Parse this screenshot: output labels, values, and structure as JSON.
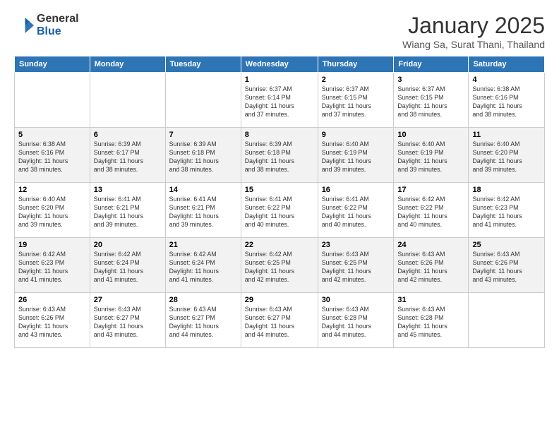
{
  "header": {
    "logo_general": "General",
    "logo_blue": "Blue",
    "month_title": "January 2025",
    "location": "Wiang Sa, Surat Thani, Thailand"
  },
  "days_of_week": [
    "Sunday",
    "Monday",
    "Tuesday",
    "Wednesday",
    "Thursday",
    "Friday",
    "Saturday"
  ],
  "weeks": [
    [
      {
        "num": "",
        "info": ""
      },
      {
        "num": "",
        "info": ""
      },
      {
        "num": "",
        "info": ""
      },
      {
        "num": "1",
        "info": "Sunrise: 6:37 AM\nSunset: 6:14 PM\nDaylight: 11 hours\nand 37 minutes."
      },
      {
        "num": "2",
        "info": "Sunrise: 6:37 AM\nSunset: 6:15 PM\nDaylight: 11 hours\nand 37 minutes."
      },
      {
        "num": "3",
        "info": "Sunrise: 6:37 AM\nSunset: 6:15 PM\nDaylight: 11 hours\nand 38 minutes."
      },
      {
        "num": "4",
        "info": "Sunrise: 6:38 AM\nSunset: 6:16 PM\nDaylight: 11 hours\nand 38 minutes."
      }
    ],
    [
      {
        "num": "5",
        "info": "Sunrise: 6:38 AM\nSunset: 6:16 PM\nDaylight: 11 hours\nand 38 minutes."
      },
      {
        "num": "6",
        "info": "Sunrise: 6:39 AM\nSunset: 6:17 PM\nDaylight: 11 hours\nand 38 minutes."
      },
      {
        "num": "7",
        "info": "Sunrise: 6:39 AM\nSunset: 6:18 PM\nDaylight: 11 hours\nand 38 minutes."
      },
      {
        "num": "8",
        "info": "Sunrise: 6:39 AM\nSunset: 6:18 PM\nDaylight: 11 hours\nand 38 minutes."
      },
      {
        "num": "9",
        "info": "Sunrise: 6:40 AM\nSunset: 6:19 PM\nDaylight: 11 hours\nand 39 minutes."
      },
      {
        "num": "10",
        "info": "Sunrise: 6:40 AM\nSunset: 6:19 PM\nDaylight: 11 hours\nand 39 minutes."
      },
      {
        "num": "11",
        "info": "Sunrise: 6:40 AM\nSunset: 6:20 PM\nDaylight: 11 hours\nand 39 minutes."
      }
    ],
    [
      {
        "num": "12",
        "info": "Sunrise: 6:40 AM\nSunset: 6:20 PM\nDaylight: 11 hours\nand 39 minutes."
      },
      {
        "num": "13",
        "info": "Sunrise: 6:41 AM\nSunset: 6:21 PM\nDaylight: 11 hours\nand 39 minutes."
      },
      {
        "num": "14",
        "info": "Sunrise: 6:41 AM\nSunset: 6:21 PM\nDaylight: 11 hours\nand 39 minutes."
      },
      {
        "num": "15",
        "info": "Sunrise: 6:41 AM\nSunset: 6:22 PM\nDaylight: 11 hours\nand 40 minutes."
      },
      {
        "num": "16",
        "info": "Sunrise: 6:41 AM\nSunset: 6:22 PM\nDaylight: 11 hours\nand 40 minutes."
      },
      {
        "num": "17",
        "info": "Sunrise: 6:42 AM\nSunset: 6:22 PM\nDaylight: 11 hours\nand 40 minutes."
      },
      {
        "num": "18",
        "info": "Sunrise: 6:42 AM\nSunset: 6:23 PM\nDaylight: 11 hours\nand 41 minutes."
      }
    ],
    [
      {
        "num": "19",
        "info": "Sunrise: 6:42 AM\nSunset: 6:23 PM\nDaylight: 11 hours\nand 41 minutes."
      },
      {
        "num": "20",
        "info": "Sunrise: 6:42 AM\nSunset: 6:24 PM\nDaylight: 11 hours\nand 41 minutes."
      },
      {
        "num": "21",
        "info": "Sunrise: 6:42 AM\nSunset: 6:24 PM\nDaylight: 11 hours\nand 41 minutes."
      },
      {
        "num": "22",
        "info": "Sunrise: 6:42 AM\nSunset: 6:25 PM\nDaylight: 11 hours\nand 42 minutes."
      },
      {
        "num": "23",
        "info": "Sunrise: 6:43 AM\nSunset: 6:25 PM\nDaylight: 11 hours\nand 42 minutes."
      },
      {
        "num": "24",
        "info": "Sunrise: 6:43 AM\nSunset: 6:26 PM\nDaylight: 11 hours\nand 42 minutes."
      },
      {
        "num": "25",
        "info": "Sunrise: 6:43 AM\nSunset: 6:26 PM\nDaylight: 11 hours\nand 43 minutes."
      }
    ],
    [
      {
        "num": "26",
        "info": "Sunrise: 6:43 AM\nSunset: 6:26 PM\nDaylight: 11 hours\nand 43 minutes."
      },
      {
        "num": "27",
        "info": "Sunrise: 6:43 AM\nSunset: 6:27 PM\nDaylight: 11 hours\nand 43 minutes."
      },
      {
        "num": "28",
        "info": "Sunrise: 6:43 AM\nSunset: 6:27 PM\nDaylight: 11 hours\nand 44 minutes."
      },
      {
        "num": "29",
        "info": "Sunrise: 6:43 AM\nSunset: 6:27 PM\nDaylight: 11 hours\nand 44 minutes."
      },
      {
        "num": "30",
        "info": "Sunrise: 6:43 AM\nSunset: 6:28 PM\nDaylight: 11 hours\nand 44 minutes."
      },
      {
        "num": "31",
        "info": "Sunrise: 6:43 AM\nSunset: 6:28 PM\nDaylight: 11 hours\nand 45 minutes."
      },
      {
        "num": "",
        "info": ""
      }
    ]
  ]
}
